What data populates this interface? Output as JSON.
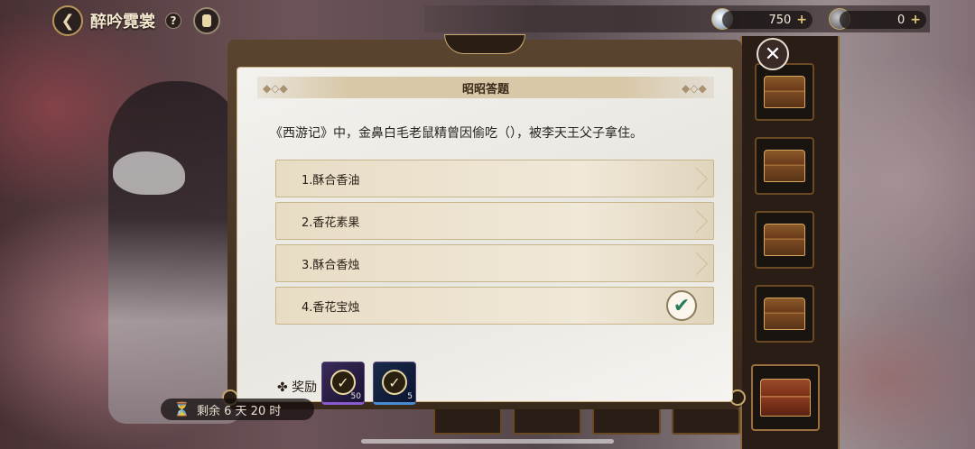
{
  "topbar": {
    "back_icon": "back-arrow-icon",
    "title": "醉吟霓裳",
    "help_label": "?",
    "currency_1": {
      "icon": "coin-icon",
      "value": "750",
      "plus": "+"
    },
    "currency_2": {
      "icon": "gear-coin-icon",
      "value": "0",
      "plus": "+"
    }
  },
  "dialog": {
    "title": "昭昭答题",
    "question": "《西游记》中，金鼻白毛老鼠精曾因偷吃（），被李天王父子拿住。",
    "options": [
      {
        "label": "1.酥合香油",
        "selected": false
      },
      {
        "label": "2.香花素果",
        "selected": false
      },
      {
        "label": "3.酥合香烛",
        "selected": false
      },
      {
        "label": "4.香花宝烛",
        "selected": true
      }
    ],
    "check_icon": "✔",
    "reward_label": "✤ 奖励",
    "rewards": [
      {
        "icon": "token-check-icon",
        "count": "50",
        "rarity": "purple"
      },
      {
        "icon": "token-check-icon",
        "count": "5",
        "rarity": "blue"
      }
    ],
    "close_icon": "✕"
  },
  "timer": {
    "icon": "hourglass-icon",
    "text": "剩余 6 天 20 时"
  },
  "colors": {
    "dialog_bg": "#f4f2ee",
    "option_bg": "#efe6d4",
    "check_color": "#2a7a5a",
    "frame_gold": "#c8a870"
  }
}
